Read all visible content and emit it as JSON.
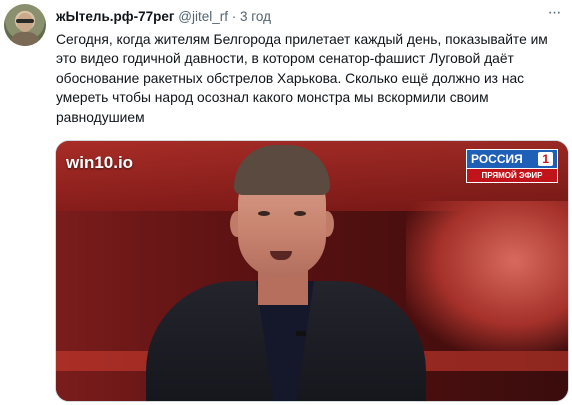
{
  "tweet": {
    "author_name": "жЫтель.рф-77рег",
    "handle": "@jitel_rf",
    "separator": "·",
    "time": "3 год",
    "more_glyph": "···",
    "text": "Сегодня, когда жителям Белгорода прилетает каждый день, показывайте им это видео годичной давности, в котором сенатор-фашист Луговой даёт обоснование ракетных обстрелов Харькова. Сколько ещё должно из нас умереть чтобы народ осознал какого монстра мы вскормили своим равнодушием"
  },
  "media": {
    "watermark": "win10.io",
    "channel_name": "РОССИЯ",
    "channel_number": "1",
    "live_label": "ПРЯМОЙ ЭФИР"
  },
  "colors": {
    "handle_gray": "#536471",
    "text_dark": "#0f1419",
    "studio_red": "#7a1c1c",
    "logo_blue": "#1e5fb8",
    "logo_red": "#c0141a"
  }
}
